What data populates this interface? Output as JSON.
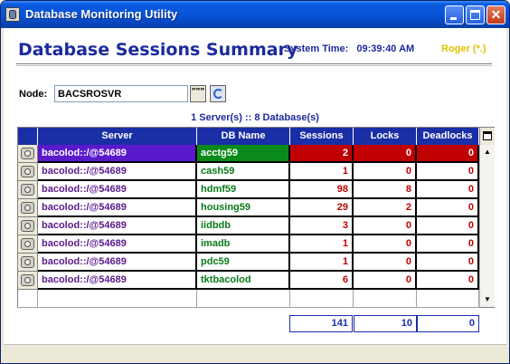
{
  "window": {
    "title": "Database Monitoring Utility"
  },
  "header": {
    "title": "Database Sessions Summary",
    "system_time_label": "System Time:",
    "system_time_value": "09:39:40 AM",
    "user": "Roger (*.)"
  },
  "node": {
    "label": "Node:",
    "value": "BACSROSVR",
    "browse_label": "\"\"\""
  },
  "summary": "1 Server(s) :: 8 Database(s)",
  "table": {
    "columns": [
      "Server",
      "DB Name",
      "Sessions",
      "Locks",
      "Deadlocks"
    ],
    "rows": [
      {
        "server": "bacolod::/@54689",
        "db": "acctg59",
        "sessions": "2",
        "locks": "0",
        "deadlocks": "0"
      },
      {
        "server": "bacolod::/@54689",
        "db": "cash59",
        "sessions": "1",
        "locks": "0",
        "deadlocks": "0"
      },
      {
        "server": "bacolod::/@54689",
        "db": "hdmf59",
        "sessions": "98",
        "locks": "8",
        "deadlocks": "0"
      },
      {
        "server": "bacolod::/@54689",
        "db": "housing59",
        "sessions": "29",
        "locks": "2",
        "deadlocks": "0"
      },
      {
        "server": "bacolod::/@54689",
        "db": "iidbdb",
        "sessions": "3",
        "locks": "0",
        "deadlocks": "0"
      },
      {
        "server": "bacolod::/@54689",
        "db": "imadb",
        "sessions": "1",
        "locks": "0",
        "deadlocks": "0"
      },
      {
        "server": "bacolod::/@54689",
        "db": "pdc59",
        "sessions": "1",
        "locks": "0",
        "deadlocks": "0"
      },
      {
        "server": "bacolod::/@54689",
        "db": "tktbacolod",
        "sessions": "6",
        "locks": "0",
        "deadlocks": "0"
      }
    ]
  },
  "totals": {
    "sessions": "141",
    "locks": "10",
    "deadlocks": "0"
  },
  "colors": {
    "header_bg": "#1A2EA6",
    "server_text": "#5A1A8C",
    "db_text": "#0A7A1A",
    "num_text": "#C00000"
  }
}
